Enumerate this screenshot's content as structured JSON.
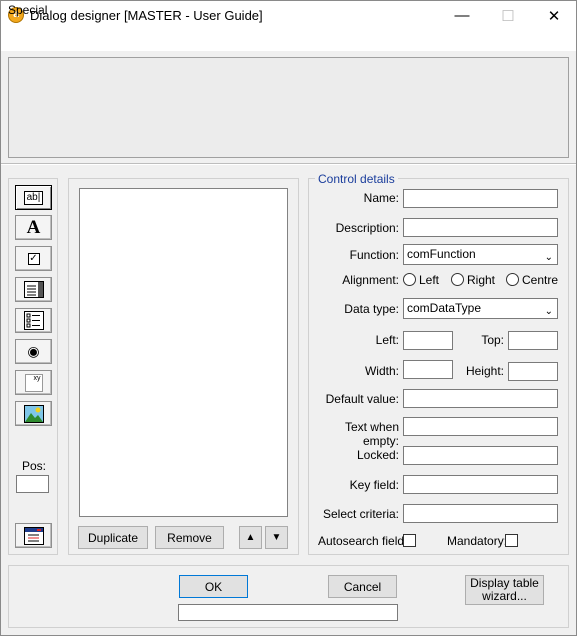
{
  "window": {
    "title": "Dialog designer [MASTER - User Guide]",
    "icon": "app-logo-icon",
    "minimize_glyph": "—",
    "maximize_glyph": "☐",
    "close_glyph": "✕"
  },
  "menu": {
    "items": [
      "Special"
    ]
  },
  "toolbox": {
    "pos_label": "Pos:",
    "pos_value": "",
    "tools": [
      "text-field-tool-icon",
      "label-tool-icon",
      "checkbox-tool-icon",
      "listbox-tool-icon",
      "combo-list-tool-icon",
      "radio-tool-icon",
      "value-field-tool-icon",
      "picture-tool-icon",
      "menu-tool-icon"
    ],
    "textfield_glyph": "ab|",
    "label_glyph": "A",
    "checkbox_glyph": "✓",
    "radio_glyph": "◉",
    "value_glyph": "xy"
  },
  "list_panel": {
    "duplicate_label": "Duplicate",
    "remove_label": "Remove",
    "up_glyph": "▲",
    "down_glyph": "▼"
  },
  "details": {
    "group_title": "Control details",
    "name_label": "Name:",
    "description_label": "Description:",
    "function_label": "Function:",
    "function_value": "comFunction",
    "alignment_label": "Alignment:",
    "align_left": "Left",
    "align_right": "Right",
    "align_centre": "Centre",
    "datatype_label": "Data type:",
    "datatype_value": "comDataType",
    "left_label": "Left:",
    "top_label": "Top:",
    "width_label": "Width:",
    "height_label": "Height:",
    "default_label": "Default value:",
    "empty_label": "Text when empty:",
    "locked_label": "Locked:",
    "keyfield_label": "Key field:",
    "select_label": "Select criteria:",
    "autosearch_label": "Autosearch field:",
    "mandatory_label": "Mandatory:",
    "chevron_glyph": "⌄"
  },
  "footer": {
    "ok_label": "OK",
    "cancel_label": "Cancel",
    "wizard_label_1": "Display table",
    "wizard_label_2": "wizard..."
  }
}
